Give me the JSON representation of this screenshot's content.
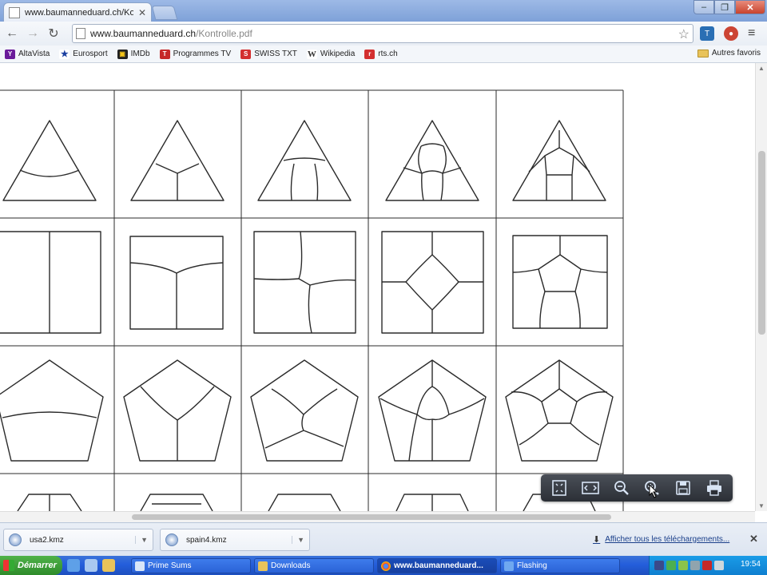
{
  "browser": {
    "tab_title": "www.baumanneduard.ch/Kor",
    "url_host": "www.baumanneduard.ch",
    "url_path": "/Kontrolle.pdf"
  },
  "bookmarks": [
    {
      "label": "AltaVista",
      "icon": "altavista-icon",
      "color": "#6a1b9a"
    },
    {
      "label": "Eurosport",
      "icon": "eurosport-icon",
      "color": "#1a3fa0"
    },
    {
      "label": "IMDb",
      "icon": "imdb-icon",
      "color": "#222222"
    },
    {
      "label": "Programmes TV",
      "icon": "tv-icon",
      "color": "#c62828"
    },
    {
      "label": "SWISS TXT",
      "icon": "swisstxt-icon",
      "color": "#d32f2f"
    },
    {
      "label": "Wikipedia",
      "icon": "wikipedia-icon",
      "color": "#555555"
    },
    {
      "label": "rts.ch",
      "icon": "rts-icon",
      "color": "#d32f2f"
    }
  ],
  "bookmarks_other": "Autres favoris",
  "pdf_toolbar": [
    "fit-page-icon",
    "fit-width-icon",
    "zoom-out-icon",
    "zoom-in-icon",
    "save-icon",
    "print-icon"
  ],
  "downloads": {
    "items": [
      {
        "name": "usa2.kmz"
      },
      {
        "name": "spain4.kmz"
      }
    ],
    "show_all": "Afficher tous les téléchargements..."
  },
  "taskbar": {
    "start": "Démarrer",
    "tasks": [
      {
        "label": "Prime Sums"
      },
      {
        "label": "Downloads"
      },
      {
        "label": "www.baumanneduard..."
      },
      {
        "label": "Flashing"
      }
    ],
    "clock": "19:54"
  }
}
